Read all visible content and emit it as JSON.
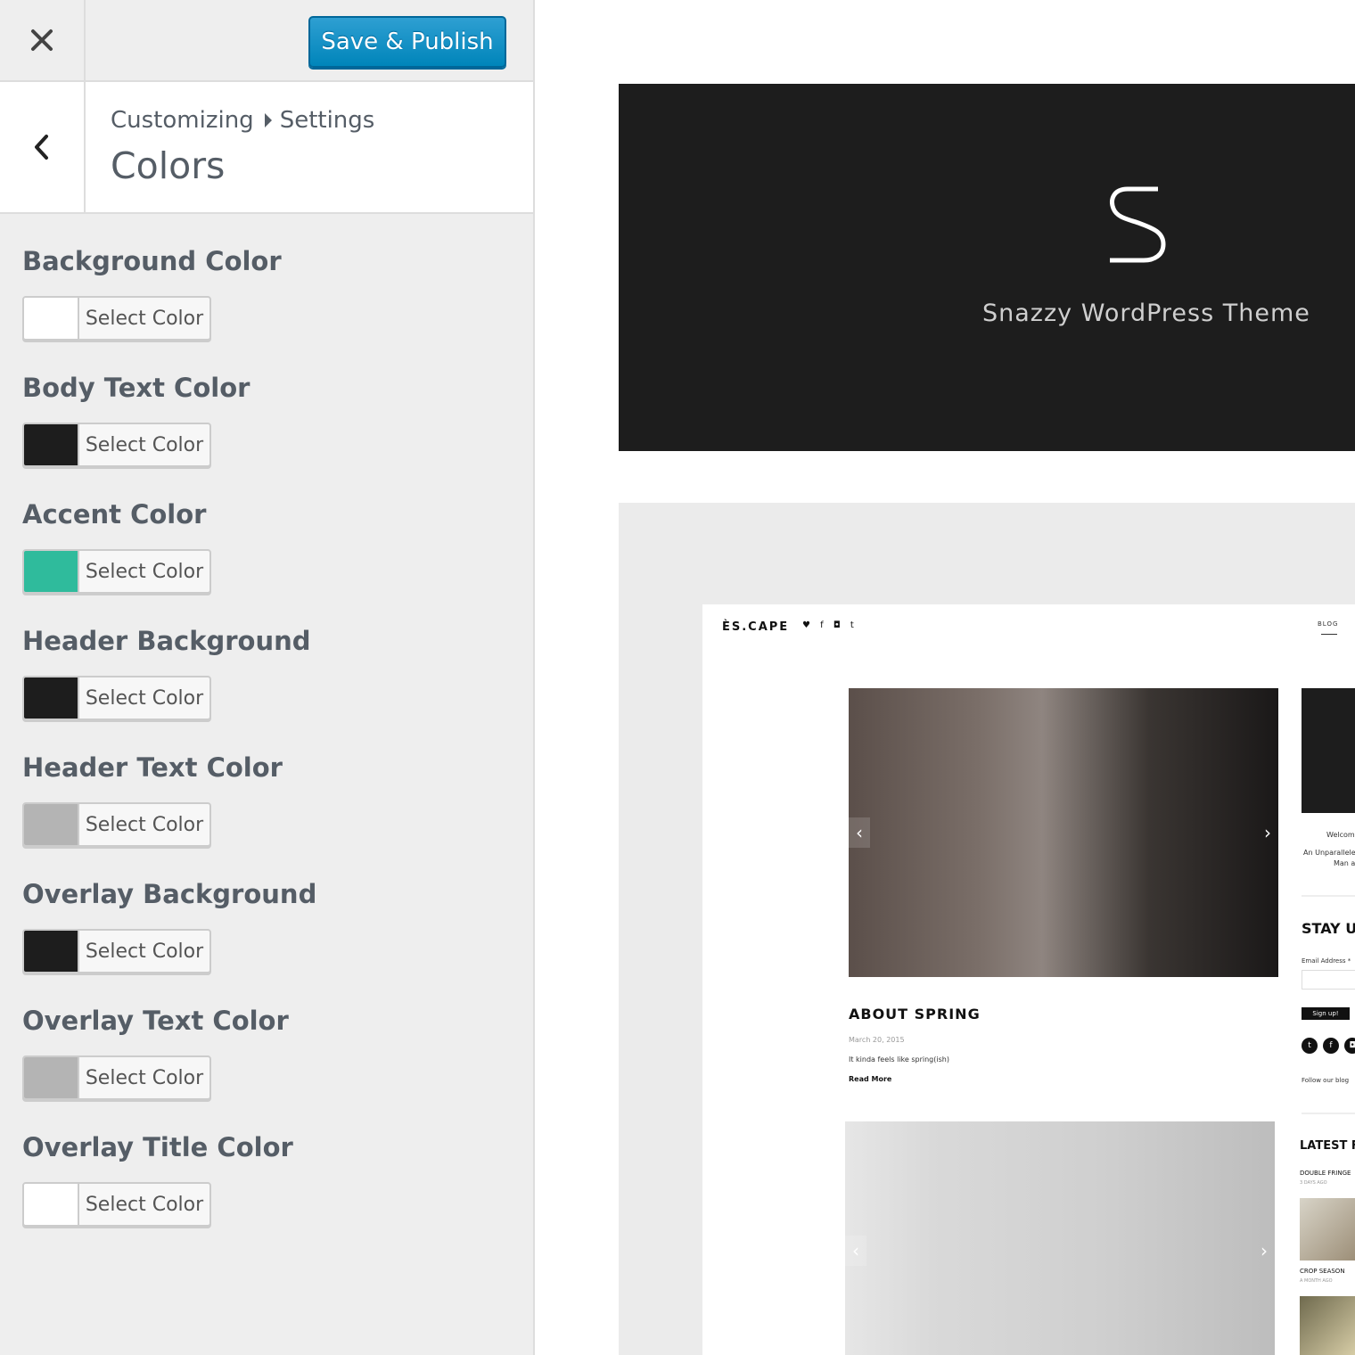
{
  "toolbar": {
    "close_icon": "close-icon",
    "save_label": "Save & Publish"
  },
  "section": {
    "back_icon": "chevron-left-icon",
    "breadcrumb": [
      "Customizing",
      "Settings"
    ],
    "title": "Colors"
  },
  "color_controls": [
    {
      "label": "Background Color",
      "swatch": "#ffffff",
      "button": "Select Color"
    },
    {
      "label": "Body Text Color",
      "swatch": "#1d1d1d",
      "button": "Select Color"
    },
    {
      "label": "Accent Color",
      "swatch": "#2fbb9c",
      "button": "Select Color"
    },
    {
      "label": "Header Background",
      "swatch": "#1d1d1d",
      "button": "Select Color"
    },
    {
      "label": "Header Text Color",
      "swatch": "#b4b4b4",
      "button": "Select Color"
    },
    {
      "label": "Overlay Background",
      "swatch": "#1d1d1d",
      "button": "Select Color"
    },
    {
      "label": "Overlay Text Color",
      "swatch": "#b4b4b4",
      "button": "Select Color"
    },
    {
      "label": "Overlay Title Color",
      "swatch": "#ffffff",
      "button": "Select Color"
    }
  ],
  "preview": {
    "hero_title": "Snazzy WordPress Theme",
    "hero_logo_icon": "s-logo-icon",
    "site": {
      "logo": "ÈS.CAPE",
      "social": "♥ f ◘ t",
      "nav": "BLOG",
      "post_title": "ABOUT SPRING",
      "post_date": "March 20, 2015",
      "post_excerpt": "It kinda feels like spring(ish)",
      "post_more": "Read More",
      "sidebar": {
        "welcome": "Welcom",
        "tagline": "An Unparallele",
        "tagline2": "Man and",
        "stay": "STAY U",
        "email_label": "Email Address *",
        "signup": "Sign up!",
        "follow": "Follow our blog",
        "latest": "LATEST F",
        "post1": "DOUBLE FRINGE",
        "post1_date": "3 DAYS AGO",
        "post2": "CROP SEASON",
        "post2_date": "A MONTH AGO"
      }
    }
  }
}
